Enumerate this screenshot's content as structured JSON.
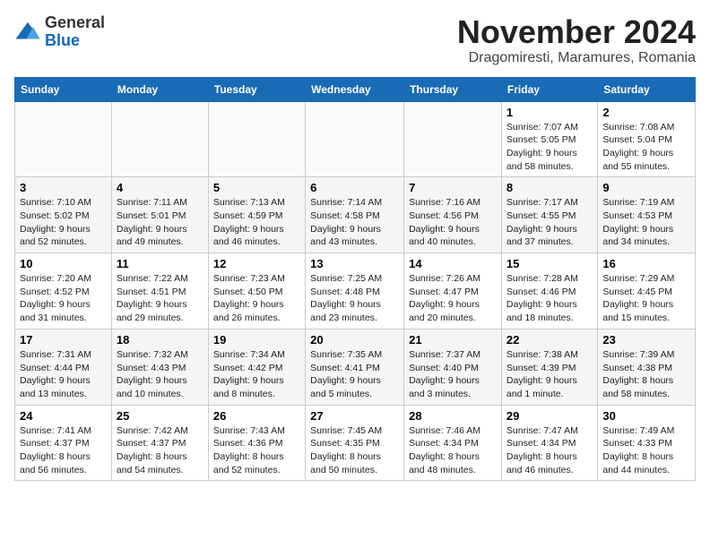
{
  "header": {
    "logo_general": "General",
    "logo_blue": "Blue",
    "month_title": "November 2024",
    "location": "Dragomiresti, Maramures, Romania"
  },
  "weekdays": [
    "Sunday",
    "Monday",
    "Tuesday",
    "Wednesday",
    "Thursday",
    "Friday",
    "Saturday"
  ],
  "weeks": [
    [
      {
        "day": "",
        "info": ""
      },
      {
        "day": "",
        "info": ""
      },
      {
        "day": "",
        "info": ""
      },
      {
        "day": "",
        "info": ""
      },
      {
        "day": "",
        "info": ""
      },
      {
        "day": "1",
        "info": "Sunrise: 7:07 AM\nSunset: 5:05 PM\nDaylight: 9 hours and 58 minutes."
      },
      {
        "day": "2",
        "info": "Sunrise: 7:08 AM\nSunset: 5:04 PM\nDaylight: 9 hours and 55 minutes."
      }
    ],
    [
      {
        "day": "3",
        "info": "Sunrise: 7:10 AM\nSunset: 5:02 PM\nDaylight: 9 hours and 52 minutes."
      },
      {
        "day": "4",
        "info": "Sunrise: 7:11 AM\nSunset: 5:01 PM\nDaylight: 9 hours and 49 minutes."
      },
      {
        "day": "5",
        "info": "Sunrise: 7:13 AM\nSunset: 4:59 PM\nDaylight: 9 hours and 46 minutes."
      },
      {
        "day": "6",
        "info": "Sunrise: 7:14 AM\nSunset: 4:58 PM\nDaylight: 9 hours and 43 minutes."
      },
      {
        "day": "7",
        "info": "Sunrise: 7:16 AM\nSunset: 4:56 PM\nDaylight: 9 hours and 40 minutes."
      },
      {
        "day": "8",
        "info": "Sunrise: 7:17 AM\nSunset: 4:55 PM\nDaylight: 9 hours and 37 minutes."
      },
      {
        "day": "9",
        "info": "Sunrise: 7:19 AM\nSunset: 4:53 PM\nDaylight: 9 hours and 34 minutes."
      }
    ],
    [
      {
        "day": "10",
        "info": "Sunrise: 7:20 AM\nSunset: 4:52 PM\nDaylight: 9 hours and 31 minutes."
      },
      {
        "day": "11",
        "info": "Sunrise: 7:22 AM\nSunset: 4:51 PM\nDaylight: 9 hours and 29 minutes."
      },
      {
        "day": "12",
        "info": "Sunrise: 7:23 AM\nSunset: 4:50 PM\nDaylight: 9 hours and 26 minutes."
      },
      {
        "day": "13",
        "info": "Sunrise: 7:25 AM\nSunset: 4:48 PM\nDaylight: 9 hours and 23 minutes."
      },
      {
        "day": "14",
        "info": "Sunrise: 7:26 AM\nSunset: 4:47 PM\nDaylight: 9 hours and 20 minutes."
      },
      {
        "day": "15",
        "info": "Sunrise: 7:28 AM\nSunset: 4:46 PM\nDaylight: 9 hours and 18 minutes."
      },
      {
        "day": "16",
        "info": "Sunrise: 7:29 AM\nSunset: 4:45 PM\nDaylight: 9 hours and 15 minutes."
      }
    ],
    [
      {
        "day": "17",
        "info": "Sunrise: 7:31 AM\nSunset: 4:44 PM\nDaylight: 9 hours and 13 minutes."
      },
      {
        "day": "18",
        "info": "Sunrise: 7:32 AM\nSunset: 4:43 PM\nDaylight: 9 hours and 10 minutes."
      },
      {
        "day": "19",
        "info": "Sunrise: 7:34 AM\nSunset: 4:42 PM\nDaylight: 9 hours and 8 minutes."
      },
      {
        "day": "20",
        "info": "Sunrise: 7:35 AM\nSunset: 4:41 PM\nDaylight: 9 hours and 5 minutes."
      },
      {
        "day": "21",
        "info": "Sunrise: 7:37 AM\nSunset: 4:40 PM\nDaylight: 9 hours and 3 minutes."
      },
      {
        "day": "22",
        "info": "Sunrise: 7:38 AM\nSunset: 4:39 PM\nDaylight: 9 hours and 1 minute."
      },
      {
        "day": "23",
        "info": "Sunrise: 7:39 AM\nSunset: 4:38 PM\nDaylight: 8 hours and 58 minutes."
      }
    ],
    [
      {
        "day": "24",
        "info": "Sunrise: 7:41 AM\nSunset: 4:37 PM\nDaylight: 8 hours and 56 minutes."
      },
      {
        "day": "25",
        "info": "Sunrise: 7:42 AM\nSunset: 4:37 PM\nDaylight: 8 hours and 54 minutes."
      },
      {
        "day": "26",
        "info": "Sunrise: 7:43 AM\nSunset: 4:36 PM\nDaylight: 8 hours and 52 minutes."
      },
      {
        "day": "27",
        "info": "Sunrise: 7:45 AM\nSunset: 4:35 PM\nDaylight: 8 hours and 50 minutes."
      },
      {
        "day": "28",
        "info": "Sunrise: 7:46 AM\nSunset: 4:34 PM\nDaylight: 8 hours and 48 minutes."
      },
      {
        "day": "29",
        "info": "Sunrise: 7:47 AM\nSunset: 4:34 PM\nDaylight: 8 hours and 46 minutes."
      },
      {
        "day": "30",
        "info": "Sunrise: 7:49 AM\nSunset: 4:33 PM\nDaylight: 8 hours and 44 minutes."
      }
    ]
  ]
}
